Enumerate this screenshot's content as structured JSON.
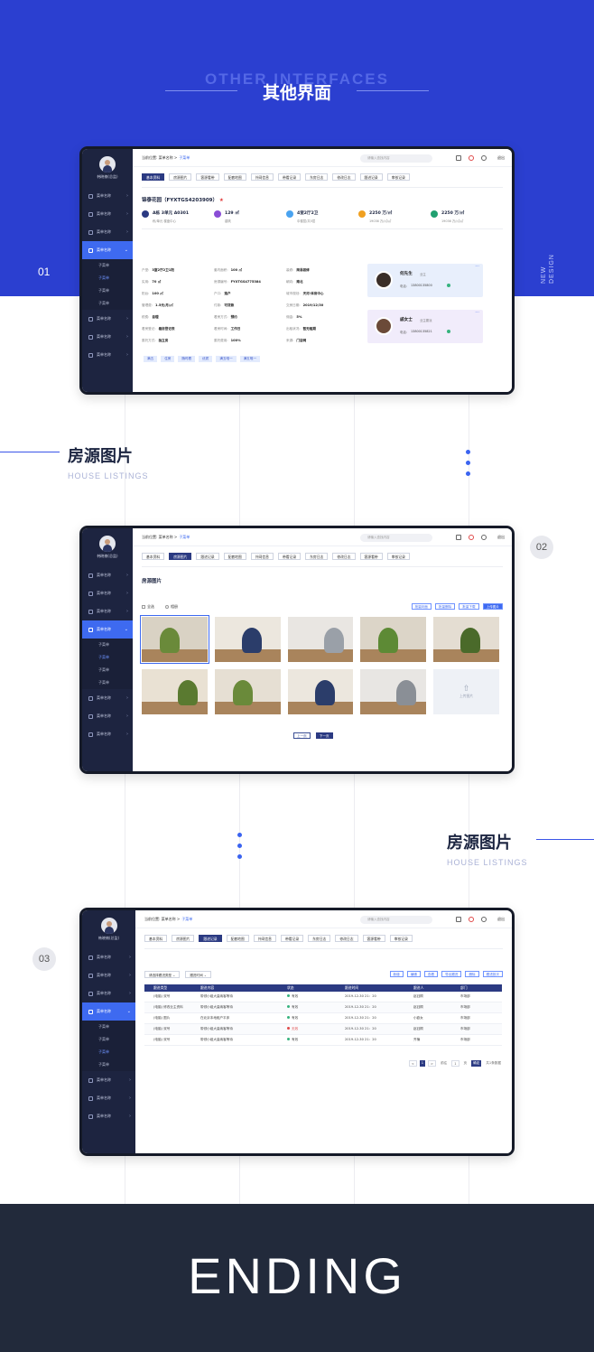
{
  "hero": {
    "title_en": "OTHER INTERFACES",
    "title_cn": "其他界面",
    "vertical_text": [
      "NEW",
      "DESIGN"
    ]
  },
  "numbers": [
    "01",
    "02",
    "03"
  ],
  "sections": [
    {
      "cn": "房源图片",
      "en": "HOUSE LISTINGS"
    },
    {
      "cn": "房源图片",
      "en": "HOUSE LISTINGS"
    }
  ],
  "ending": "ENDING",
  "app": {
    "user_name": "韩晓楠(总监)",
    "menu": [
      "菜单名称",
      "菜单名称",
      "菜单名称",
      "菜单名称",
      "菜单名称",
      "菜单名称",
      "菜单名称"
    ],
    "submenu": [
      "子菜单",
      "子菜单",
      "子菜单",
      "子菜单"
    ],
    "breadcrumb_label": "当前位置:",
    "breadcrumb_parent": "菜单名称 >",
    "breadcrumb_current": "子菜单",
    "search_placeholder": "请输入查找内容",
    "exit_label": "退出"
  },
  "screen1": {
    "tabs": [
      "基本资料",
      "房源图片",
      "客源看带",
      "配套地图",
      "外网信息",
      "带看记录",
      "东房日志",
      "修改日志",
      "跟进记录",
      "审核记录"
    ],
    "title": "锦泰花园（FYXTGS4203909）",
    "star": "★",
    "stats": [
      {
        "v": "A栋 3单元 A0301",
        "l": "栋/单元 楼盘中心"
      },
      {
        "v": "129 ㎡",
        "l": "建筑"
      },
      {
        "v": "4室2厅2卫",
        "l": "中楼层/共5层"
      },
      {
        "v": "2250 万/㎡",
        "l": "19036 万/㎡/㎡",
        "pre": "售价"
      },
      {
        "v": "2250 万/㎡",
        "l": "19036 万/㎡/㎡",
        "pre": "售价"
      }
    ],
    "details": [
      [
        "户型:",
        "3室2厅2卫1阳",
        "套内面积:",
        "100 ㎡",
        "装修:",
        "简易装修"
      ],
      [
        "实用:",
        "70 ㎡",
        "房源编号:",
        "FYXTGS4775384",
        "朝向:",
        "南北"
      ],
      [
        "阳台:",
        "100 ㎡",
        "户口:",
        "落户",
        "城市规划:",
        "天河·体育中心"
      ],
      [
        "管理费:",
        "1.5元/月/㎡",
        "付款:",
        "可贷款",
        "交房日期:",
        "2019/12/30"
      ],
      [
        "税费:",
        "自理",
        "看房方式:",
        "预约",
        "佣金:",
        "5%"
      ],
      [
        "看房登记:",
        "看房登记表",
        "看房时间:",
        "工作日",
        "出租状况:",
        "暂无租期"
      ],
      [
        "委托方式:",
        "独立房",
        "委托费用:",
        "100%",
        "来源:",
        "门店网"
      ]
    ],
    "contacts": [
      {
        "name": "何先生",
        "role": "业主",
        "phone_label": "电话:",
        "phone": "13800135800",
        "more": "···"
      },
      {
        "name": "戚女士",
        "role": "业主委派",
        "phone_label": "电话:",
        "phone": "13800135821",
        "more": "···"
      }
    ],
    "tags": [
      "满五",
      "住房",
      "随时看",
      "优质",
      "满五唯一",
      "满五唯一"
    ]
  },
  "screen2": {
    "tabs": [
      "基本资料",
      "房源图片",
      "跟进记录",
      "配套地图",
      "外网信息",
      "带看记录",
      "东房日志",
      "修改日志",
      "客源看带",
      "审核记录"
    ],
    "heading": "房源图片",
    "select_all": "全选",
    "invert": "相册",
    "actions": [
      "批量封面",
      "批量删除",
      "批量下载",
      "上传图片"
    ],
    "upload_label": "上传图片",
    "prev": "上一页",
    "next": "下一页"
  },
  "screen3": {
    "tabs": [
      "基本资料",
      "房源图片",
      "跟进记录",
      "配套地图",
      "外网信息",
      "带看记录",
      "东房日志",
      "修改日志",
      "客源看带",
      "审核记录"
    ],
    "filters": [
      "请选择跟进类型",
      "跟进时间"
    ],
    "actions": [
      "新增",
      "编辑",
      "查看",
      "导出跟进",
      "删除",
      "跟进批次"
    ],
    "columns": [
      "跟进类型",
      "跟进内容",
      "状态",
      "跟进时间",
      "跟进人",
      "部门"
    ],
    "rows": [
      {
        "type": "(电脑)  双号",
        "content": "带领小组大量纳客等待",
        "status": "有效",
        "time": "2019-12-30  21：20",
        "person": "赵钰桐",
        "dept": "市场部",
        "bad": false
      },
      {
        "type": "(电脑)  修改业主资料",
        "content": "带领小组大量纳客等待",
        "status": "有效",
        "time": "2019-12-30  21：20",
        "person": "赵钰桐",
        "dept": "市场部",
        "bad": false
      },
      {
        "type": "(电脑)  图片",
        "content": "在北京本地租户平床",
        "status": "有效",
        "time": "2019-12-30  21：20",
        "person": "小欧女",
        "dept": "市场部",
        "bad": false
      },
      {
        "type": "(电脑)  双号",
        "content": "带领小组大量纳客等待",
        "status": "无效",
        "time": "2019-12-30  21：20",
        "person": "赵钰桐",
        "dept": "市场部",
        "bad": true
      },
      {
        "type": "(电脑)  双号",
        "content": "带领小组大量纳客等待",
        "status": "有效",
        "time": "2019-12-30  21：20",
        "person": "齐楠",
        "dept": "市场部",
        "bad": false
      }
    ],
    "pager": [
      "<",
      "1",
      ">",
      "前往",
      "1",
      "页",
      "确定",
      "共1条数据"
    ]
  }
}
